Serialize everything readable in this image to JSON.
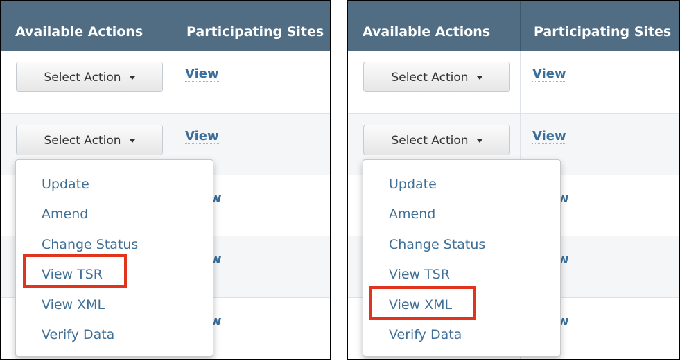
{
  "panels": [
    {
      "headers": {
        "actions": "Available Actions",
        "sites": "Participating Sites"
      },
      "select_label": "Select Action",
      "view_label": "View",
      "menu_items": [
        "Update",
        "Amend",
        "Change Status",
        "View TSR",
        "View XML",
        "Verify Data"
      ],
      "highlighted_item": "View TSR"
    },
    {
      "headers": {
        "actions": "Available Actions",
        "sites": "Participating Sites"
      },
      "select_label": "Select Action",
      "view_label": "View",
      "menu_items": [
        "Update",
        "Amend",
        "Change Status",
        "View TSR",
        "View XML",
        "Verify Data"
      ],
      "highlighted_item": "View XML"
    }
  ],
  "clipped_link_fragment": "w",
  "colors": {
    "header_bg": "#506d83",
    "link": "#3a6f9b",
    "highlight": "#e0341c"
  }
}
